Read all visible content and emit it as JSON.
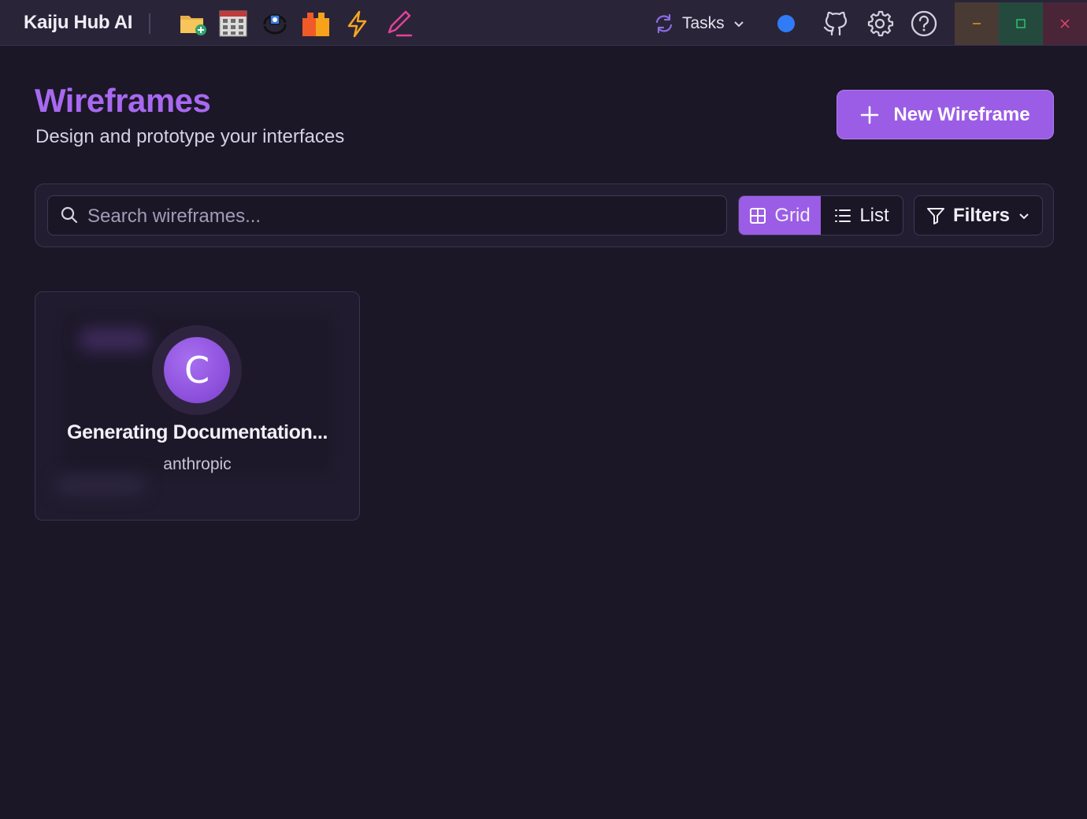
{
  "app": {
    "title": "Kaiju Hub AI",
    "tasks_label": "Tasks",
    "toolbar_icons": [
      "folder-add-icon",
      "calculator-icon",
      "sync-robot-icon",
      "blocks-icon",
      "lightning-icon",
      "pen-icon"
    ],
    "right_icons": [
      "status-dot",
      "github-icon",
      "gear-icon",
      "help-icon"
    ],
    "window_controls": [
      "minimize",
      "maximize",
      "close"
    ]
  },
  "header": {
    "title": "Wireframes",
    "subtitle": "Design and prototype your interfaces",
    "new_button_label": "New Wireframe"
  },
  "toolbar": {
    "search_placeholder": "Search wireframes...",
    "view_grid_label": "Grid",
    "view_list_label": "List",
    "active_view": "Grid",
    "filters_label": "Filters"
  },
  "cards": [
    {
      "avatar_letter": "C",
      "title": "Generating Documentation...",
      "author": "anthropic"
    }
  ],
  "colors": {
    "accent": "#9b5de5",
    "title_accent": "#a869f0",
    "background": "#1b1727",
    "status_dot": "#2f7cf6"
  }
}
